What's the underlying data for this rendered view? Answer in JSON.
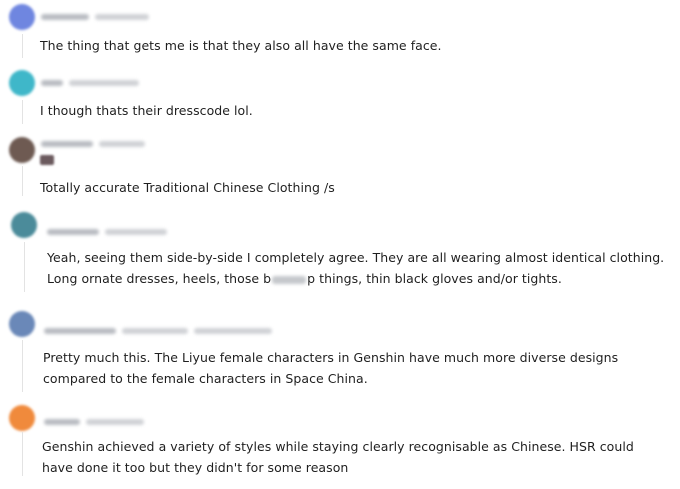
{
  "comments": [
    {
      "id": "c1",
      "avatar_color": "#6f86e0",
      "text": "The thing that gets me is that they also all have the same face."
    },
    {
      "id": "c2",
      "avatar_color": "#3fb7c9",
      "text": "I though thats their dresscode lol."
    },
    {
      "id": "c3",
      "avatar_color": "#6e5a52",
      "text": "Totally accurate Traditional Chinese Clothing /s"
    },
    {
      "id": "c4",
      "avatar_color": "#4b8b9a",
      "text_line1": "Yeah, seeing them side-by-side I completely agree. They are all wearing almost identical clothing.",
      "text_line2_a": "Long ornate dresses, heels, those b",
      "text_line2_b": "p things, thin black gloves and/or tights."
    },
    {
      "id": "c5",
      "avatar_color": "#6a88b8",
      "text_line1": "Pretty much this. The Liyue female characters in Genshin have much more diverse designs",
      "text_line2": "compared to the female characters in Space China."
    },
    {
      "id": "c6",
      "avatar_color": "#f08a3c",
      "text_line1": "Genshin achieved a variety of styles while staying clearly recognisable as Chinese. HSR could",
      "text_line2": "have done it too but they didn't for some reason"
    }
  ]
}
